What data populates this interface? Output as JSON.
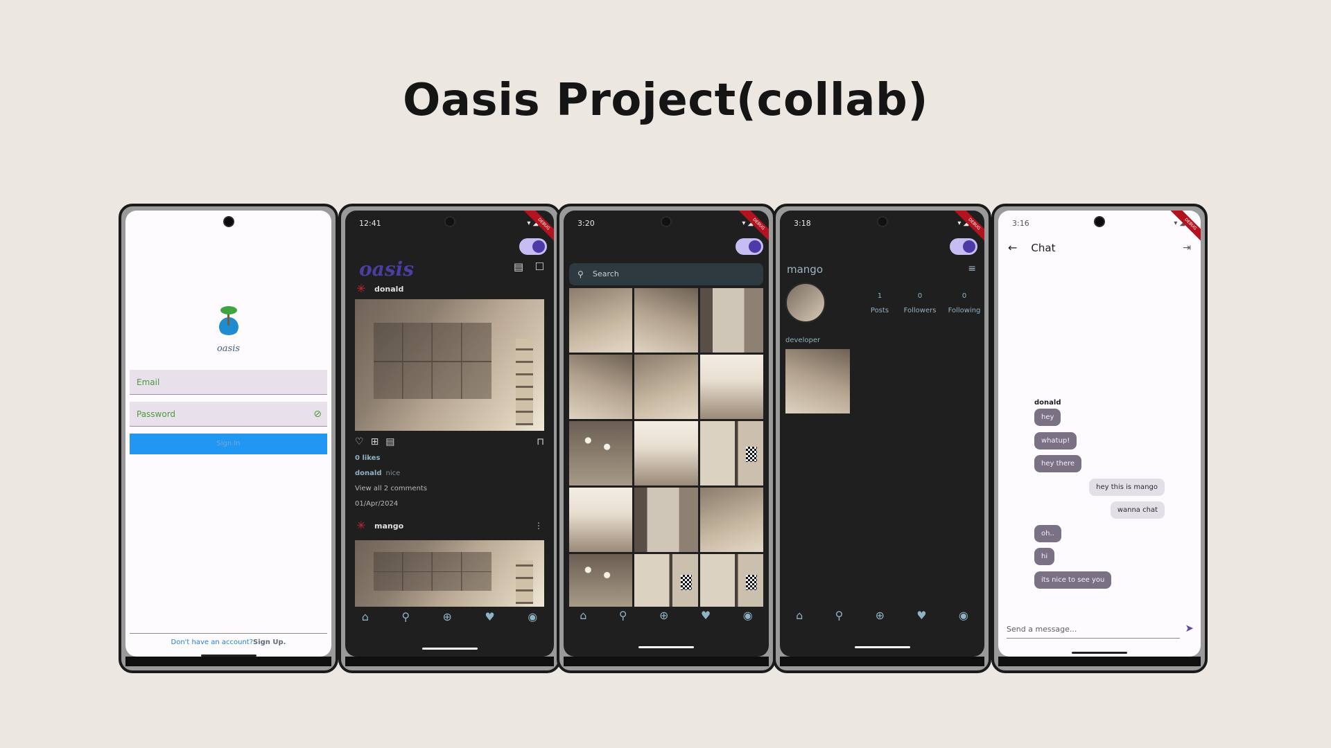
{
  "page": {
    "title": "Oasis Project(collab)"
  },
  "status": {
    "phone2_time": "12:41",
    "phone3_time": "3:20",
    "phone4_time": "3:18",
    "phone5_time": "3:16"
  },
  "login": {
    "logo_text": "oasis",
    "email_placeholder": "Email",
    "password_placeholder": "Password",
    "signin_label": "Sign In",
    "signup_prompt": "Don't have an account?",
    "signup_link": "Sign Up."
  },
  "feed": {
    "logo_text": "oasis",
    "posts": [
      {
        "user": "donald",
        "likes": "0 likes",
        "caption_user": "donald",
        "caption": "nice",
        "comments": "View all 2 comments",
        "date": "01/Apr/2024"
      },
      {
        "user": "mango"
      }
    ]
  },
  "search": {
    "placeholder": "Search"
  },
  "profile": {
    "username": "mango",
    "stats": [
      {
        "value": "1",
        "label": "Posts"
      },
      {
        "value": "0",
        "label": "Followers"
      },
      {
        "value": "0",
        "label": "Following"
      }
    ],
    "bio": "developer"
  },
  "chat": {
    "title": "Chat",
    "sender": "donald",
    "messages": [
      {
        "text": "hey",
        "dir": "in"
      },
      {
        "text": "whatup!",
        "dir": "in"
      },
      {
        "text": "hey there",
        "dir": "in"
      },
      {
        "text": "hey this is mango",
        "dir": "out"
      },
      {
        "text": "wanna chat",
        "dir": "out"
      },
      {
        "text": "oh..",
        "dir": "in"
      },
      {
        "text": "hi",
        "dir": "in"
      },
      {
        "text": "its nice to see you",
        "dir": "in"
      }
    ],
    "input_placeholder": "Send a message..."
  },
  "icons": {
    "home": "home-icon",
    "search": "search-icon",
    "add": "add-circle-icon",
    "favorite": "heart-icon",
    "account": "account-icon",
    "send": "send-icon"
  },
  "colors": {
    "accent": "#4e39a8",
    "signin_button": "#2196f3",
    "dark_bg": "#1f1f1f",
    "light_bg": "#fefbff"
  }
}
